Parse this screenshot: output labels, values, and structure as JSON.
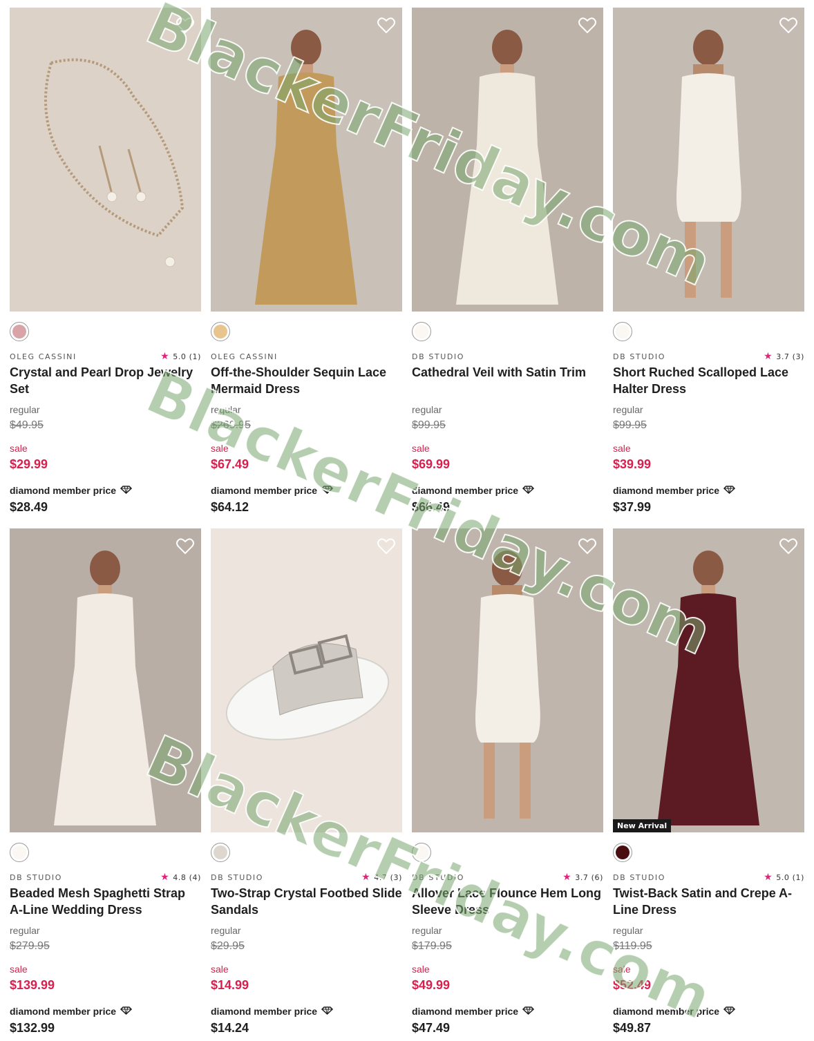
{
  "products": [
    {
      "brand": "OLEG CASSINI",
      "rating": "5.0 (1)",
      "name": "Crystal and Pearl Drop Jewelry Set",
      "regular_label": "regular",
      "regular_price": "$49.95",
      "sale_label": "sale",
      "sale_price": "$29.99",
      "member_label": "diamond member price",
      "member_price": "$28.49",
      "swatch_color": "#d9a4a8",
      "image": "jewelry",
      "bg": "#dcd2c8"
    },
    {
      "brand": "OLEG CASSINI",
      "rating": "",
      "name": "Off-the-Shoulder Sequin Lace Mermaid Dress",
      "regular_label": "regular",
      "regular_price": "$269.95",
      "sale_label": "sale",
      "sale_price": "$67.49",
      "member_label": "diamond member price",
      "member_price": "$64.12",
      "swatch_color": "#e8c48e",
      "image": "dress",
      "dress_color": "#c29b5c",
      "bg": "#c9c0b7"
    },
    {
      "brand": "DB STUDIO",
      "rating": "",
      "name": "Cathedral Veil with Satin Trim",
      "regular_label": "regular",
      "regular_price": "$99.95",
      "sale_label": "sale",
      "sale_price": "$69.99",
      "member_label": "diamond member price",
      "member_price": "$66.49",
      "swatch_color": "#fbf8f3",
      "image": "dress",
      "dress_color": "#efe8dd",
      "bg": "#bdb3a9"
    },
    {
      "brand": "DB STUDIO",
      "rating": "3.7 (3)",
      "name": "Short Ruched Scalloped Lace Halter Dress",
      "regular_label": "regular",
      "regular_price": "$99.95",
      "sale_label": "sale",
      "sale_price": "$39.99",
      "member_label": "diamond member price",
      "member_price": "$37.99",
      "swatch_color": "#fbf8f3",
      "image": "short",
      "dress_color": "#f3efe7",
      "bg": "#c4bbb2"
    },
    {
      "brand": "DB STUDIO",
      "rating": "4.8 (4)",
      "name": "Beaded Mesh Spaghetti Strap A-Line Wedding Dress",
      "regular_label": "regular",
      "regular_price": "$279.95",
      "sale_label": "sale",
      "sale_price": "$139.99",
      "member_label": "diamond member price",
      "member_price": "$132.99",
      "swatch_color": "#fbf8f3",
      "image": "dress",
      "dress_color": "#f2ebe4",
      "bg": "#b9aea5"
    },
    {
      "brand": "DB STUDIO",
      "rating": "4.7 (3)",
      "name": "Two-Strap Crystal Footbed Slide Sandals",
      "regular_label": "regular",
      "regular_price": "$29.95",
      "sale_label": "sale",
      "sale_price": "$14.99",
      "member_label": "diamond member price",
      "member_price": "$14.24",
      "swatch_color": "#ddd7cf",
      "image": "sandal",
      "bg": "#ece4dd"
    },
    {
      "brand": "DB STUDIO",
      "rating": "3.7 (6)",
      "name": "Allover Lace Flounce Hem Long Sleeve Dress",
      "regular_label": "regular",
      "regular_price": "$179.95",
      "sale_label": "sale",
      "sale_price": "$49.99",
      "member_label": "diamond member price",
      "member_price": "$47.49",
      "swatch_color": "#fbf8f3",
      "image": "short",
      "dress_color": "#f4efe6",
      "bg": "#bfb5ac"
    },
    {
      "brand": "DB STUDIO",
      "rating": "5.0 (1)",
      "name": "Twist-Back Satin and Crepe A-Line Dress",
      "regular_label": "regular",
      "regular_price": "$119.95",
      "sale_label": "sale",
      "sale_price": "$52.49",
      "member_label": "diamond member price",
      "member_price": "$49.87",
      "swatch_color": "#4a0e10",
      "badge": "New Arrival",
      "image": "dress",
      "dress_color": "#5c1a23",
      "bg": "#c1b8af"
    }
  ],
  "watermark": "BlackerFriday.com"
}
